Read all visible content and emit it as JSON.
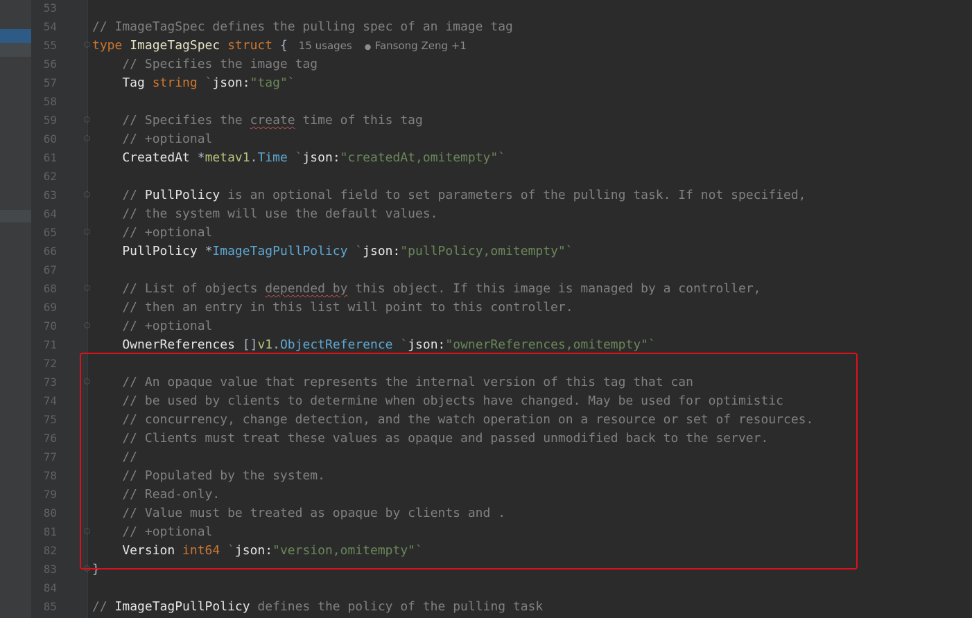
{
  "editor": {
    "inlay_usages": "15 usages",
    "inlay_author": "Fansong Zeng +1"
  },
  "lines": [
    {
      "n": "53"
    },
    {
      "n": "54",
      "parts": [
        [
          "cm",
          "// ImageTagSpec defines the pulling spec of an image tag"
        ]
      ]
    },
    {
      "n": "55",
      "parts": [
        [
          "kw",
          "type "
        ],
        [
          "tn",
          "ImageTagSpec "
        ],
        [
          "kw",
          "struct "
        ],
        [
          "punct",
          "{"
        ]
      ]
    },
    {
      "n": "56",
      "parts": [
        [
          "cm",
          "    // Specifies the image tag"
        ]
      ]
    },
    {
      "n": "57",
      "parts": [
        [
          "fld",
          "    Tag "
        ],
        [
          "kw",
          "string "
        ],
        [
          "str",
          "`"
        ],
        [
          "tag-key",
          "json:"
        ],
        [
          "str",
          "\"tag\"`"
        ]
      ]
    },
    {
      "n": "58"
    },
    {
      "n": "59",
      "parts": [
        [
          "cm",
          "    // Specifies the "
        ],
        [
          "cm sq",
          "create"
        ],
        [
          "cm",
          " time of this tag"
        ]
      ]
    },
    {
      "n": "60",
      "parts": [
        [
          "cm",
          "    // +optional"
        ]
      ]
    },
    {
      "n": "61",
      "parts": [
        [
          "fld",
          "    CreatedAt "
        ],
        [
          "punct",
          "*"
        ],
        [
          "pkg",
          "metav1"
        ],
        [
          "punct",
          "."
        ],
        [
          "tp",
          "Time "
        ],
        [
          "str",
          "`"
        ],
        [
          "tag-key",
          "json:"
        ],
        [
          "str",
          "\"createdAt,omitempty\"`"
        ]
      ]
    },
    {
      "n": "62"
    },
    {
      "n": "63",
      "parts": [
        [
          "cm",
          "    // "
        ],
        [
          "fld",
          "PullPolicy"
        ],
        [
          "cm",
          " is an optional field to set parameters of the pulling task. If not specified,"
        ]
      ]
    },
    {
      "n": "64",
      "parts": [
        [
          "cm",
          "    // the system will use the default values."
        ]
      ]
    },
    {
      "n": "65",
      "parts": [
        [
          "cm",
          "    // +optional"
        ]
      ]
    },
    {
      "n": "66",
      "parts": [
        [
          "fld",
          "    PullPolicy "
        ],
        [
          "punct",
          "*"
        ],
        [
          "tp",
          "ImageTagPullPolicy "
        ],
        [
          "str",
          "`"
        ],
        [
          "tag-key",
          "json:"
        ],
        [
          "str",
          "\"pullPolicy,omitempty\"`"
        ]
      ]
    },
    {
      "n": "67"
    },
    {
      "n": "68",
      "parts": [
        [
          "cm",
          "    // List of objects "
        ],
        [
          "cm sq",
          "depended by"
        ],
        [
          "cm",
          " this object. If this image is managed by a controller,"
        ]
      ]
    },
    {
      "n": "69",
      "parts": [
        [
          "cm",
          "    // then an entry in this list will point to this controller."
        ]
      ]
    },
    {
      "n": "70",
      "parts": [
        [
          "cm",
          "    // +optional"
        ]
      ]
    },
    {
      "n": "71",
      "parts": [
        [
          "fld",
          "    OwnerReferences "
        ],
        [
          "punct",
          "[]"
        ],
        [
          "pkg",
          "v1"
        ],
        [
          "punct",
          "."
        ],
        [
          "tp",
          "ObjectReference "
        ],
        [
          "str",
          "`"
        ],
        [
          "tag-key",
          "json:"
        ],
        [
          "str",
          "\"ownerReferences,omitempty\"`"
        ]
      ]
    },
    {
      "n": "72"
    },
    {
      "n": "73",
      "parts": [
        [
          "cm",
          "    // An opaque value that represents the internal version of this tag that can"
        ]
      ]
    },
    {
      "n": "74",
      "parts": [
        [
          "cm",
          "    // be used by clients to determine when objects have changed. May be used for optimistic"
        ]
      ]
    },
    {
      "n": "75",
      "parts": [
        [
          "cm",
          "    // concurrency, change detection, and the watch operation on a resource or set of resources."
        ]
      ]
    },
    {
      "n": "76",
      "parts": [
        [
          "cm",
          "    // Clients must treat these values as opaque and passed unmodified back to the server."
        ]
      ]
    },
    {
      "n": "77",
      "parts": [
        [
          "cm",
          "    //"
        ]
      ]
    },
    {
      "n": "78",
      "parts": [
        [
          "cm",
          "    // Populated by the system."
        ]
      ]
    },
    {
      "n": "79",
      "parts": [
        [
          "cm",
          "    // Read-only."
        ]
      ]
    },
    {
      "n": "80",
      "parts": [
        [
          "cm",
          "    // Value must be treated as opaque by clients and ."
        ]
      ]
    },
    {
      "n": "81",
      "parts": [
        [
          "cm",
          "    // +optional"
        ]
      ]
    },
    {
      "n": "82",
      "parts": [
        [
          "fld",
          "    Version "
        ],
        [
          "kw",
          "int64 "
        ],
        [
          "str",
          "`"
        ],
        [
          "tag-key",
          "json:"
        ],
        [
          "str",
          "\"version,omitempty\"`"
        ]
      ]
    },
    {
      "n": "83",
      "parts": [
        [
          "punct",
          "}"
        ]
      ]
    },
    {
      "n": "84"
    },
    {
      "n": "85",
      "parts": [
        [
          "cm",
          "// "
        ],
        [
          "fld",
          "ImageTagPullPolicy"
        ],
        [
          "cm",
          " defines the policy of the pulling task"
        ]
      ]
    }
  ],
  "folds": [
    "55",
    "59",
    "60",
    "63",
    "65",
    "68",
    "70",
    "73",
    "81",
    "83"
  ],
  "highlight_color": "#e0101a",
  "accent": "#2d5b86"
}
